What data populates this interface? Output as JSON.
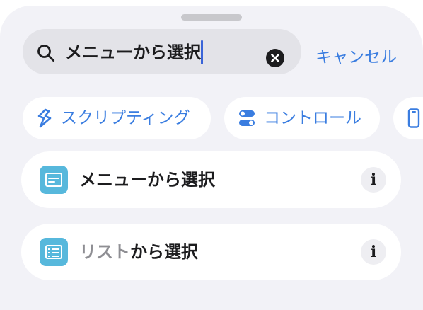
{
  "search": {
    "query": "メニューから選択",
    "cancel_label": "キャンセル"
  },
  "categories": [
    {
      "label": "スクリプティング",
      "icon": "scripting-icon"
    },
    {
      "label": "コントロール",
      "icon": "toggle-controls-icon"
    },
    {
      "label": "",
      "icon": "device-icon"
    }
  ],
  "results": [
    {
      "label": "メニューから選択",
      "label_dim": "",
      "label_rest": "",
      "icon": "menu-list-icon"
    },
    {
      "label": "",
      "label_dim": "リスト",
      "label_rest": "から選択",
      "icon": "list-icon"
    }
  ],
  "info_glyph": "i",
  "colors": {
    "accent": "#3a7de0",
    "action_icon": "#57b8dc",
    "sheet_background": "#f2f2f7",
    "search_field": "#e3e3e8"
  }
}
